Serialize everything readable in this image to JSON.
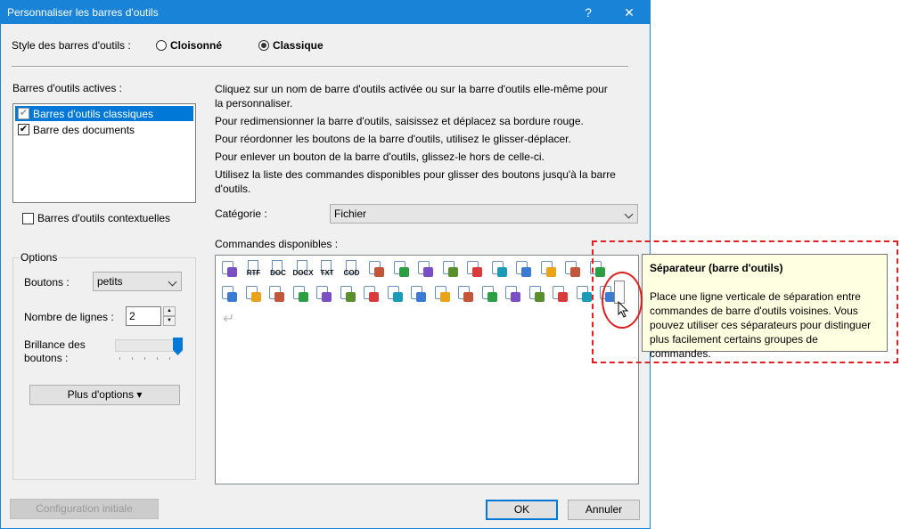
{
  "window": {
    "title": "Personnaliser les barres d'outils",
    "help_label": "?",
    "close_label": "✕"
  },
  "style": {
    "label": "Style des barres d'outils :",
    "options": [
      {
        "label": "Cloisonné",
        "checked": false
      },
      {
        "label": "Classique",
        "checked": true
      }
    ]
  },
  "active_toolbars": {
    "label": "Barres d'outils actives :",
    "items": [
      {
        "label": "Barres d'outils classiques",
        "checked": true,
        "selected": true
      },
      {
        "label": "Barre des documents",
        "checked": true,
        "selected": false
      }
    ],
    "contextual_label": "Barres d'outils contextuelles"
  },
  "instructions": [
    "Cliquez sur un nom de barre d'outils activée ou sur la barre d'outils elle-même pour",
    "la personnaliser.",
    "Pour redimensionner la barre d'outils, saisissez et déplacez sa bordure rouge.",
    "Pour réordonner les boutons de la barre d'outils, utilisez le glisser-déplacer.",
    "Pour enlever un bouton de la barre d'outils, glissez-le hors de celle-ci.",
    "Utilisez la liste des commandes disponibles pour glisser des boutons jusqu'à la barre",
    "d'outils."
  ],
  "options": {
    "group_label": "Options",
    "buttons_label": "Boutons :",
    "buttons_value": "petits",
    "lines_label": "Nombre de lignes :",
    "lines_value": "2",
    "brightness_label_1": "Brillance des",
    "brightness_label_2": "boutons :",
    "brightness_level": 1.0,
    "more_label": "Plus d'options ▾"
  },
  "category": {
    "label": "Catégorie :",
    "value": "Fichier"
  },
  "commands": {
    "label": "Commandes disponibles :",
    "row1": [
      {
        "name": "new-doc-icon",
        "text": ""
      },
      {
        "name": "rtf-icon",
        "text": "RTF"
      },
      {
        "name": "doc-icon",
        "text": "DOC"
      },
      {
        "name": "docx-icon",
        "text": "DOCX"
      },
      {
        "name": "txt-icon",
        "text": "TXT"
      },
      {
        "name": "cod-icon",
        "text": "COD"
      },
      {
        "name": "open-icon",
        "text": ""
      },
      {
        "name": "wizard-icon",
        "text": ""
      },
      {
        "name": "copy-doc-icon",
        "text": ""
      },
      {
        "name": "save-icon",
        "text": ""
      },
      {
        "name": "save-as-icon",
        "text": ""
      },
      {
        "name": "export-icon",
        "text": ""
      },
      {
        "name": "web-icon",
        "text": ""
      },
      {
        "name": "print-icon",
        "text": ""
      },
      {
        "name": "save-close-icon",
        "text": ""
      },
      {
        "name": "tools-icon",
        "text": ""
      }
    ],
    "row2": [
      {
        "name": "merge-icon"
      },
      {
        "name": "network-icon"
      },
      {
        "name": "compare-icon"
      },
      {
        "name": "zoom-icon"
      },
      {
        "name": "help-icon"
      },
      {
        "name": "preview-icon"
      },
      {
        "name": "edit-icon"
      },
      {
        "name": "import-icon"
      },
      {
        "name": "export-doc-icon"
      },
      {
        "name": "send-icon"
      },
      {
        "name": "mail-icon"
      },
      {
        "name": "mail-multi-icon"
      },
      {
        "name": "fax-icon"
      },
      {
        "name": "delete-doc-icon"
      },
      {
        "name": "close-doc-icon"
      },
      {
        "name": "package-icon"
      },
      {
        "name": "folder-icon"
      }
    ],
    "enter_glyph": "↵"
  },
  "tooltip": {
    "title": "Séparateur (barre d'outils)",
    "body_1": "Place une ligne verticale de séparation entre",
    "body_2": "commandes de barre d'outils voisines. Vous",
    "body_3": "pouvez utiliser ces séparateurs pour distinguer",
    "body_4": "plus facilement certains groupes de commandes."
  },
  "footer": {
    "reset_label": "Configuration initiale",
    "ok_label": "OK",
    "cancel_label": "Annuler"
  },
  "colors": {
    "titlebar": "#1883d7",
    "selection": "#0078d7",
    "annotation": "#e02020",
    "tooltip_bg": "#ffffe1"
  }
}
